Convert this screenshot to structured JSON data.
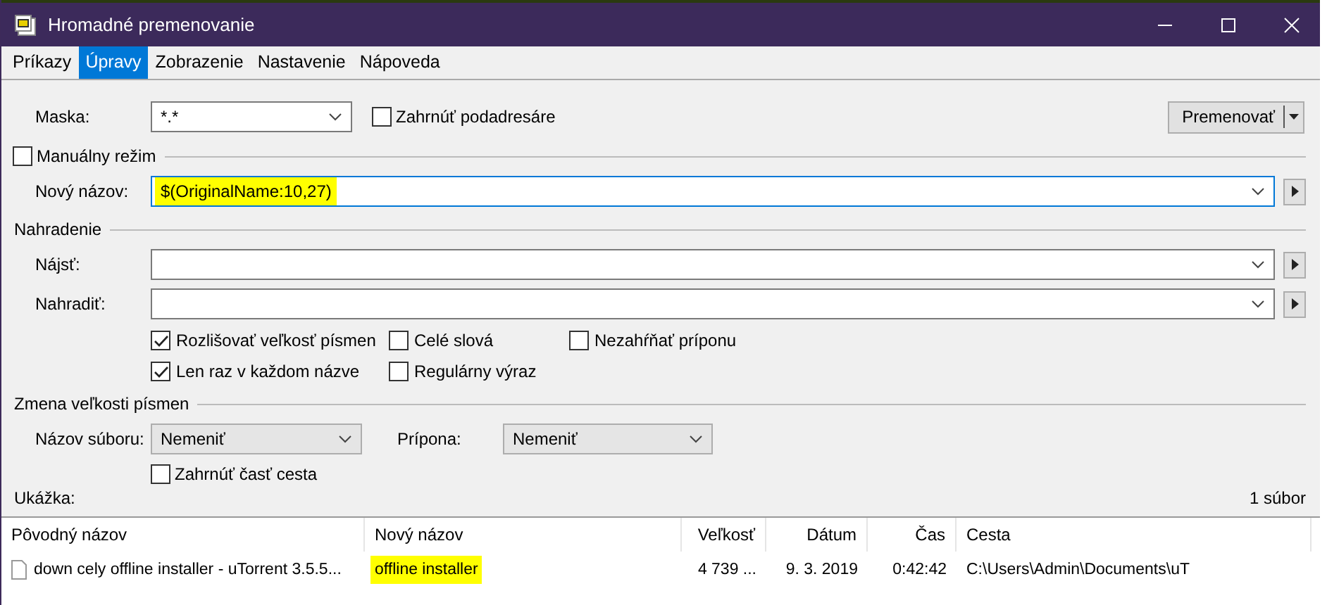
{
  "window": {
    "title": "Hromadné premenovanie"
  },
  "menu": [
    {
      "label": "Príkazy",
      "selected": false
    },
    {
      "label": "Úpravy",
      "selected": true
    },
    {
      "label": "Zobrazenie",
      "selected": false
    },
    {
      "label": "Nastavenie",
      "selected": false
    },
    {
      "label": "Nápoveda",
      "selected": false
    }
  ],
  "mask": {
    "label": "Maska:",
    "value": "*.*"
  },
  "include_subfolders": {
    "label": "Zahrnúť podadresáre",
    "checked": false
  },
  "rename_button": {
    "label": "Premenovať"
  },
  "manual_mode": {
    "label": "Manuálny režim",
    "checked": false
  },
  "new_name": {
    "label": "Nový názov:",
    "value": "$(OriginalName:10,27)",
    "highlighted": true
  },
  "replace_section": {
    "title": "Nahradenie"
  },
  "find": {
    "label": "Nájsť:"
  },
  "replace": {
    "label": "Nahradiť:"
  },
  "options": [
    {
      "label": "Rozlišovať veľkosť písmen",
      "checked": true
    },
    {
      "label": "Celé slová",
      "checked": false
    },
    {
      "label": "Nezahŕňať príponu",
      "checked": false
    },
    {
      "label": "Len raz v každom názve",
      "checked": true
    },
    {
      "label": "Regulárny výraz",
      "checked": false
    }
  ],
  "case_section": {
    "title": "Zmena veľkosti písmen"
  },
  "file_name_case": {
    "label": "Názov súboru:",
    "value": "Nemeniť"
  },
  "extension_case": {
    "label": "Prípona:",
    "value": "Nemeniť"
  },
  "include_path": {
    "label": "Zahrnúť časť cesta",
    "checked": false
  },
  "preview": {
    "label": "Ukážka:",
    "count": "1 súbor"
  },
  "table": {
    "columns": [
      "Pôvodný názov",
      "Nový názov",
      "Veľkosť",
      "Dátum",
      "Čas",
      "Cesta"
    ],
    "rows": [
      {
        "cells": [
          {
            "text": "down cely offline installer - uTorrent 3.5.5...",
            "highlighted": false
          },
          {
            "text": "offline installer",
            "highlighted": true
          },
          {
            "text": "4 739 ...",
            "highlighted": false
          },
          {
            "text": "9. 3. 2019",
            "highlighted": false
          },
          {
            "text": "0:42:42",
            "highlighted": false
          },
          {
            "text": "C:\\Users\\Admin\\Documents\\uT",
            "highlighted": false
          }
        ]
      }
    ]
  }
}
